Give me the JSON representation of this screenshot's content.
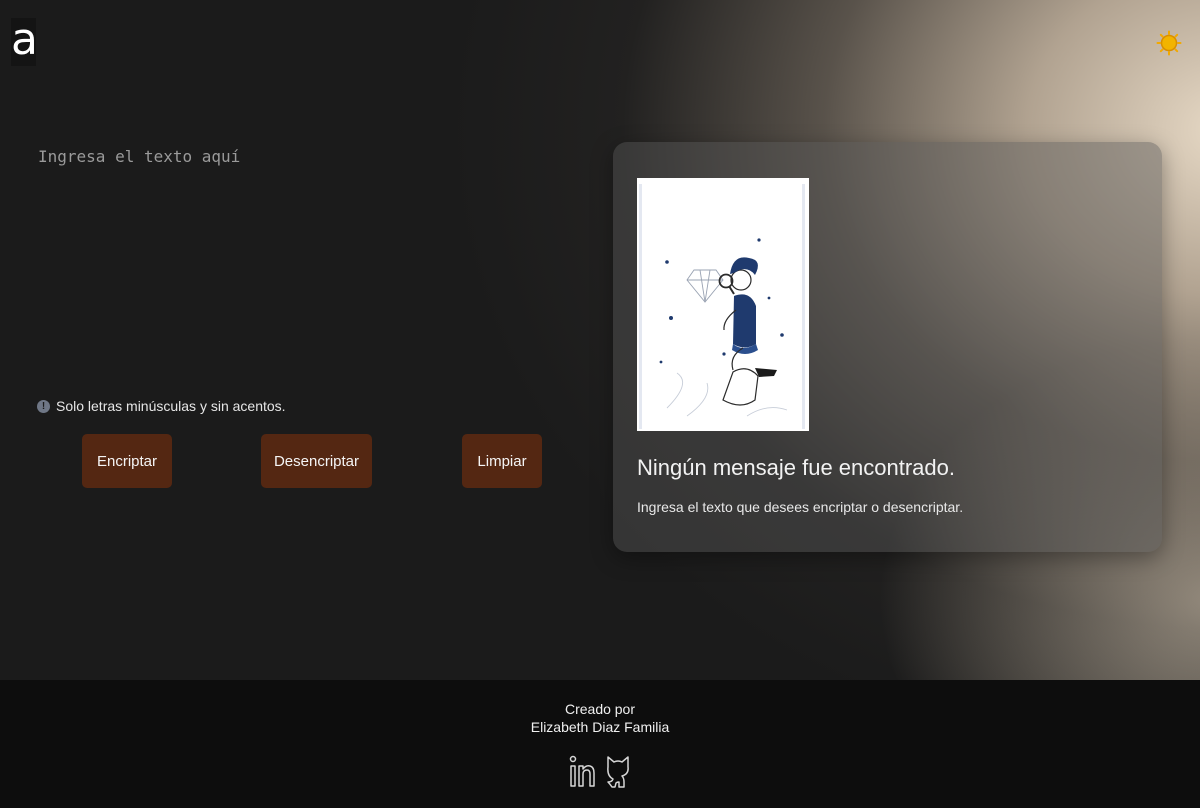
{
  "header": {
    "logo_letter": "a"
  },
  "input": {
    "placeholder": "Ingresa el texto aquí"
  },
  "hint": {
    "text": "Solo letras minúsculas y sin acentos.",
    "icon_glyph": "!"
  },
  "buttons": {
    "encrypt": "Encriptar",
    "decrypt": "Desencriptar",
    "clear": "Limpiar"
  },
  "output": {
    "title": "Ningún mensaje fue encontrado.",
    "subtitle": "Ingresa el texto que desees encriptar o desencriptar."
  },
  "footer": {
    "created_by": "Creado por",
    "author": "Elizabeth Diaz Familia"
  },
  "colors": {
    "background": "#1b1b1b",
    "button": "#542712",
    "footer": "#0d0d0d",
    "sun": "#f2a900",
    "illustration_accent": "#1f3a6e"
  },
  "icons": [
    "logo-icon",
    "sun-icon",
    "info-icon",
    "linkedin-icon",
    "github-icon"
  ]
}
